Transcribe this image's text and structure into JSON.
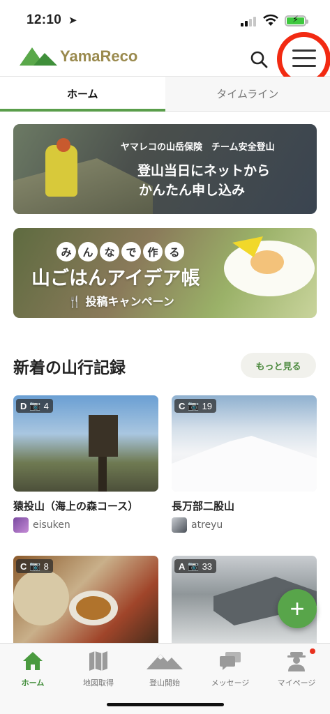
{
  "status": {
    "time": "12:10"
  },
  "header": {
    "logo_text": "YamaReco",
    "brand_color": "#5a9e4b"
  },
  "tabs": [
    {
      "label": "ホーム",
      "active": true
    },
    {
      "label": "タイムライン",
      "active": false
    }
  ],
  "banners": {
    "insurance": {
      "small": "ヤマレコの山岳保険　チーム安全登山",
      "line1": "登山当日にネットから",
      "line2": "かんたん申し込み"
    },
    "campaign": {
      "chars": [
        "み",
        "ん",
        "な",
        "で",
        "作",
        "る"
      ],
      "title": "山ごはんアイデア帳",
      "sub": "投稿キャンペーン"
    }
  },
  "section": {
    "title": "新着の山行記録",
    "more": "もっと見る"
  },
  "records": [
    {
      "grade": "D",
      "photos": "4",
      "title": "猿投山（海上の森コース）",
      "user": "eisuken"
    },
    {
      "grade": "C",
      "photos": "19",
      "title": "長万部二股山",
      "user": "atreyu"
    },
    {
      "grade": "C",
      "photos": "8",
      "title": "",
      "user": ""
    },
    {
      "grade": "A",
      "photos": "33",
      "title": "",
      "user": ""
    }
  ],
  "fab": {
    "label": "+"
  },
  "bottom_nav": [
    {
      "label": "ホーム",
      "icon": "home-icon",
      "active": true
    },
    {
      "label": "地図取得",
      "icon": "map-icon",
      "active": false
    },
    {
      "label": "登山開始",
      "icon": "mountain-icon",
      "active": false
    },
    {
      "label": "メッセージ",
      "icon": "chat-icon",
      "active": false
    },
    {
      "label": "マイページ",
      "icon": "user-icon",
      "active": false
    }
  ]
}
